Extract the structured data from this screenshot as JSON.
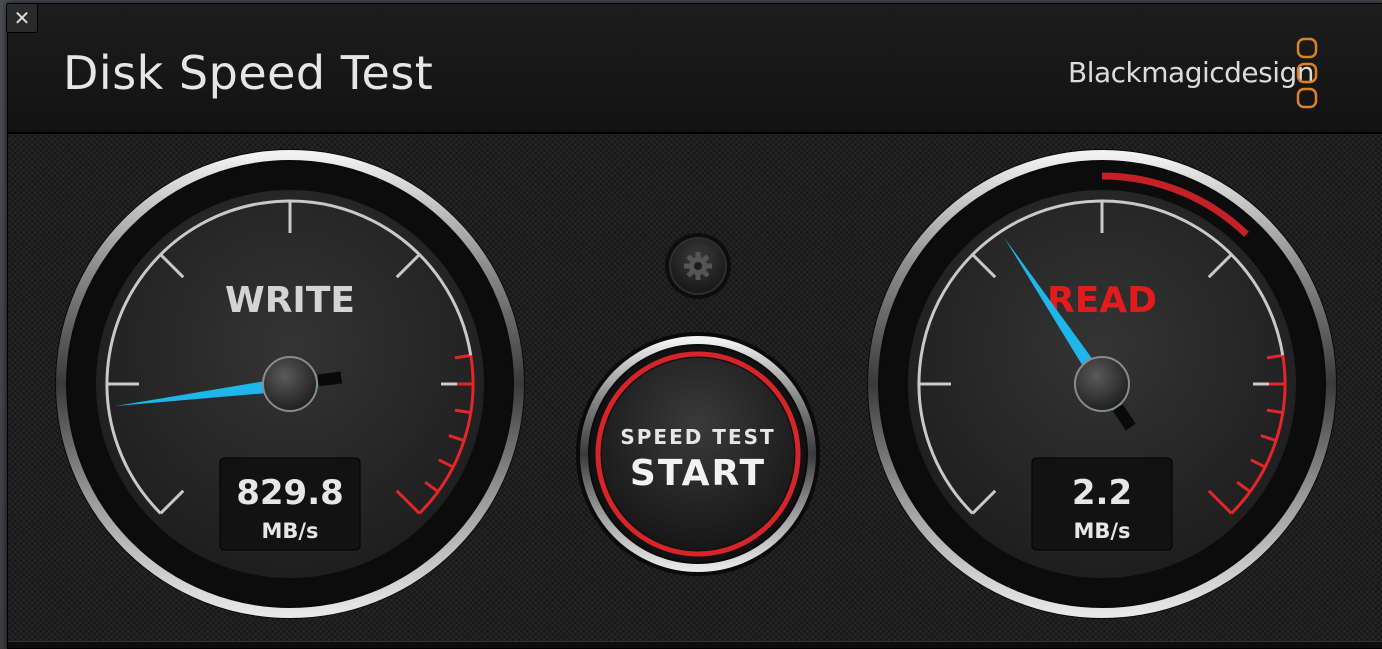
{
  "window": {
    "close_glyph": "✕",
    "title": "Disk Speed Test",
    "brand": "Blackmagicdesign"
  },
  "write_gauge": {
    "label": "WRITE",
    "value": "829.8",
    "unit": "MB/s",
    "needle_fraction": 0.14,
    "label_color": "#d4d4d4"
  },
  "read_gauge": {
    "label": "READ",
    "value": "2.2",
    "unit": "MB/s",
    "needle_fraction": 0.375,
    "label_color": "#e31b1b"
  },
  "start_button": {
    "line1": "SPEED TEST",
    "line2": "START"
  },
  "settings": {
    "icon": "gear-icon"
  },
  "colors": {
    "needle": "#1fb6ea",
    "redline": "#e3262a",
    "logo": "#d9822b",
    "text": "#e6e6e6"
  }
}
